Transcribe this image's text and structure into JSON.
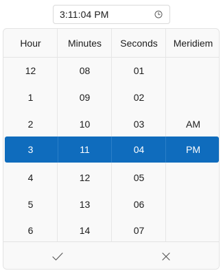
{
  "time_input": {
    "value": "3:11:04 PM",
    "icon": "clock-icon"
  },
  "picker": {
    "columns": [
      {
        "id": "hour",
        "title": "Hour",
        "values": [
          "12",
          "1",
          "2",
          "3",
          "4",
          "5",
          "6"
        ],
        "selected": "3"
      },
      {
        "id": "minutes",
        "title": "Minutes",
        "values": [
          "08",
          "09",
          "10",
          "11",
          "12",
          "13",
          "14"
        ],
        "selected": "11"
      },
      {
        "id": "seconds",
        "title": "Seconds",
        "values": [
          "01",
          "02",
          "03",
          "04",
          "05",
          "06",
          "07"
        ],
        "selected": "04"
      },
      {
        "id": "meridiem",
        "title": "Meridiem",
        "values": [
          "",
          "",
          "AM",
          "PM",
          "",
          "",
          ""
        ],
        "selected": "PM"
      }
    ],
    "accent_color": "#0f6cbd"
  },
  "footer": {
    "accept_icon": "checkmark-icon",
    "dismiss_icon": "close-icon"
  }
}
